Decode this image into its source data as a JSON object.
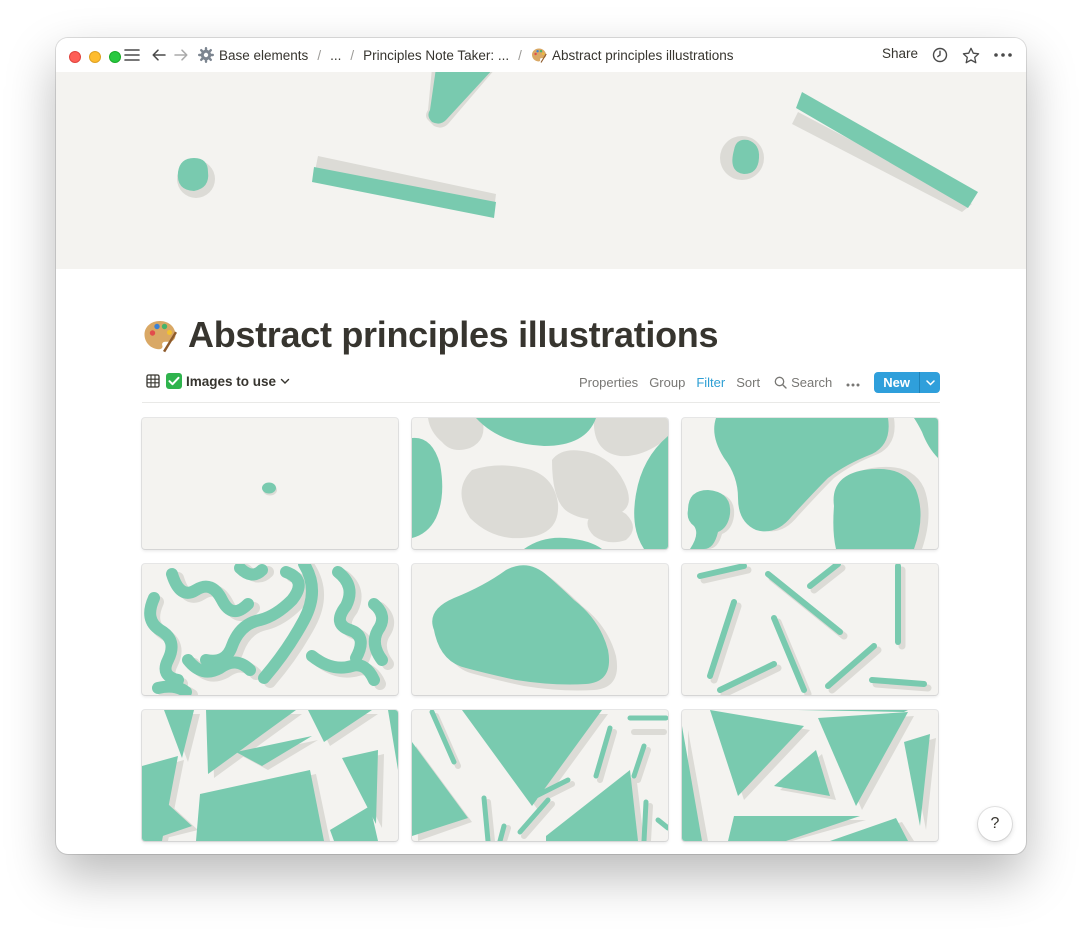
{
  "window": {
    "breadcrumbs": [
      {
        "label": "Base elements",
        "icon": "gear-icon"
      },
      {
        "label": "..."
      },
      {
        "label": "Principles Note Taker: ..."
      },
      {
        "label": "Abstract principles illustrations",
        "icon": "palette-icon"
      }
    ],
    "share_label": "Share",
    "icons": [
      "sidebar-toggle-icon",
      "back-arrow-icon",
      "forward-arrow-icon",
      "clock-icon",
      "star-icon",
      "more-icon"
    ]
  },
  "page": {
    "title": "Abstract principles illustrations",
    "title_icon": "palette-icon",
    "cover_colors": {
      "shape": "#79caaf",
      "shadow": "#dcdbd6",
      "background": "#f4f3f0"
    }
  },
  "database": {
    "view_label": "Images to use",
    "view_icon": "gallery-icon",
    "toolbar": {
      "properties": "Properties",
      "group": "Group",
      "filter": "Filter",
      "sort": "Sort",
      "search": "Search",
      "new": "New"
    },
    "accent_color": "#2f9fdb",
    "cards": [
      {
        "pattern": "single-dot"
      },
      {
        "pattern": "blobs-gray-green"
      },
      {
        "pattern": "large-blobs"
      },
      {
        "pattern": "squiggles"
      },
      {
        "pattern": "single-blob"
      },
      {
        "pattern": "sticks"
      },
      {
        "pattern": "triangles-a"
      },
      {
        "pattern": "triangles-b"
      },
      {
        "pattern": "triangles-c"
      }
    ]
  },
  "help_label": "?"
}
